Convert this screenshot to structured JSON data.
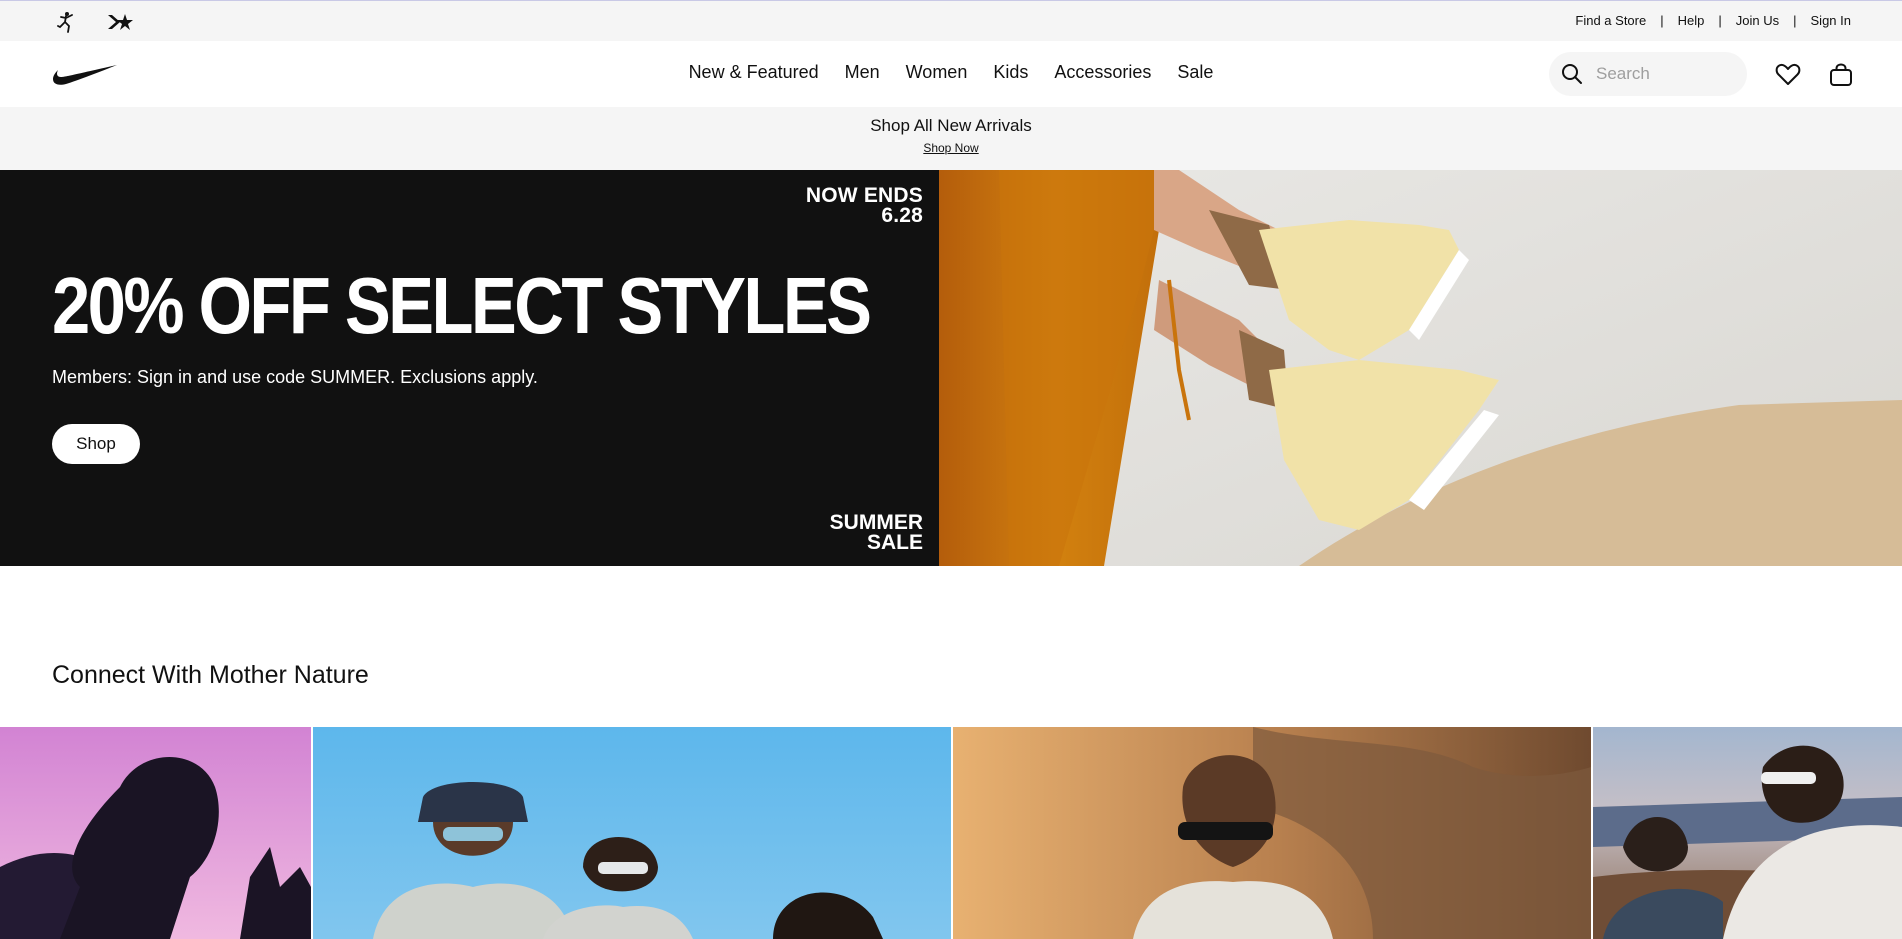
{
  "utility": {
    "links": [
      "Find a Store",
      "Help",
      "Join Us",
      "Sign In"
    ],
    "separator": "|"
  },
  "nav": {
    "items": [
      "New & Featured",
      "Men",
      "Women",
      "Kids",
      "Accessories",
      "Sale"
    ],
    "search_placeholder": "Search"
  },
  "promo": {
    "title": "Shop All New Arrivals",
    "link": "Shop Now"
  },
  "hero": {
    "ends_line1": "NOW ENDS",
    "ends_line2": "6.28",
    "headline": "20% OFF SELECT STYLES",
    "subtext": "Members: Sign in and use code SUMMER. Exclusions apply.",
    "button": "Shop",
    "tag_line1": "SUMMER",
    "tag_line2": "SALE"
  },
  "section": {
    "title": "Connect With Mother Nature"
  },
  "icons": [
    "jordan-jumpman-icon",
    "converse-star-chevron-icon",
    "nike-swoosh-logo",
    "search-icon",
    "heart-icon",
    "bag-icon"
  ],
  "colors": {
    "utility_bg": "#f5f5f5",
    "hero_bg": "#111111",
    "text": "#111111"
  }
}
